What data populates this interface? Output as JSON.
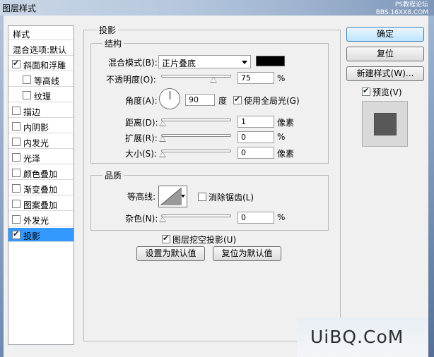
{
  "window": {
    "title": "图层样式",
    "watermark_lines": [
      "PS教程论坛",
      "BBS.16XX8.COM"
    ]
  },
  "style_list": {
    "header": "样式",
    "blend_item": "混合选项:默认",
    "items": [
      {
        "label": "斜面和浮雕",
        "checked": true
      },
      {
        "label": "等高线",
        "checked": false
      },
      {
        "label": "纹理",
        "checked": false
      },
      {
        "label": "描边",
        "checked": false
      },
      {
        "label": "内阴影",
        "checked": false
      },
      {
        "label": "内发光",
        "checked": false
      },
      {
        "label": "光泽",
        "checked": false
      },
      {
        "label": "颜色叠加",
        "checked": false
      },
      {
        "label": "渐变叠加",
        "checked": false
      },
      {
        "label": "图案叠加",
        "checked": false
      },
      {
        "label": "外发光",
        "checked": false
      },
      {
        "label": "投影",
        "checked": true,
        "selected": true
      }
    ]
  },
  "panel": {
    "title": "投影",
    "structure": {
      "legend": "结构",
      "blend_mode_label": "混合模式(B):",
      "blend_mode_value": "正片叠底",
      "shadow_color": "#000000",
      "opacity_label": "不透明度(O):",
      "opacity_value": "75",
      "opacity_unit": "%",
      "opacity_fraction": 0.75,
      "angle_label": "角度(A):",
      "angle_value": "90",
      "angle_unit": "度",
      "global_light_label": "使用全局光(G)",
      "global_light_checked": true,
      "distance_label": "距离(D):",
      "distance_value": "1",
      "distance_unit": "像素",
      "spread_label": "扩展(R):",
      "spread_value": "0",
      "spread_unit": "%",
      "size_label": "大小(S):",
      "size_value": "0",
      "size_unit": "像素"
    },
    "quality": {
      "legend": "品质",
      "contour_label": "等高线:",
      "anti_alias_label": "消除锯齿(L)",
      "anti_alias_checked": false,
      "noise_label": "杂色(N):",
      "noise_value": "0",
      "noise_unit": "%"
    },
    "knockout_label": "图层挖空投影(U)",
    "knockout_checked": true,
    "make_default": "设置为默认值",
    "reset_default": "复位为默认值"
  },
  "actions": {
    "ok": "确定",
    "reset": "复位",
    "new_style": "新建样式(W)...",
    "preview_label": "预览(V)",
    "preview_checked": true
  },
  "brand": "UiBQ.CoM",
  "colors": {
    "selection": "#3399ff",
    "primary_button": "#bee6fd"
  }
}
